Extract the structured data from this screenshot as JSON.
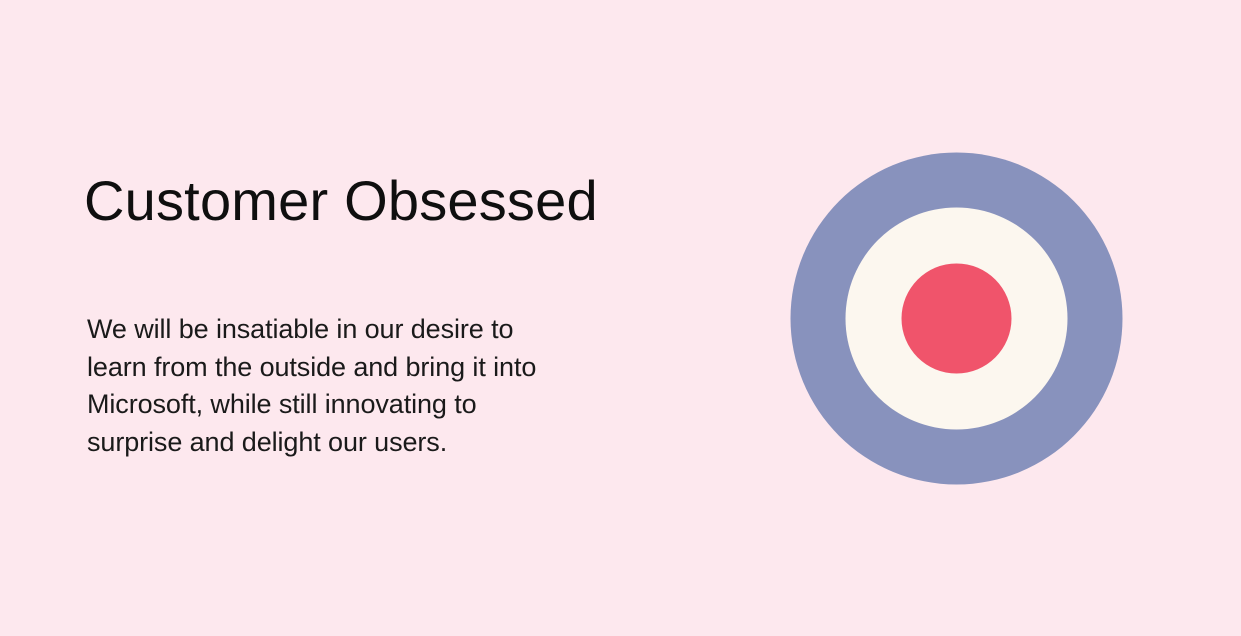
{
  "slide": {
    "title": "Customer Obsessed",
    "body_lines": [
      "We will be insatiable in our desire to",
      "learn from the outside and bring it into",
      "Microsoft, while still innovating to",
      "surprise and delight our users."
    ]
  },
  "colors": {
    "background": "#fde8ee",
    "target_outer": "#8892bd",
    "target_middle": "#fcf7ef",
    "target_center": "#f0546b"
  },
  "icons": {
    "target": "target-icon"
  }
}
